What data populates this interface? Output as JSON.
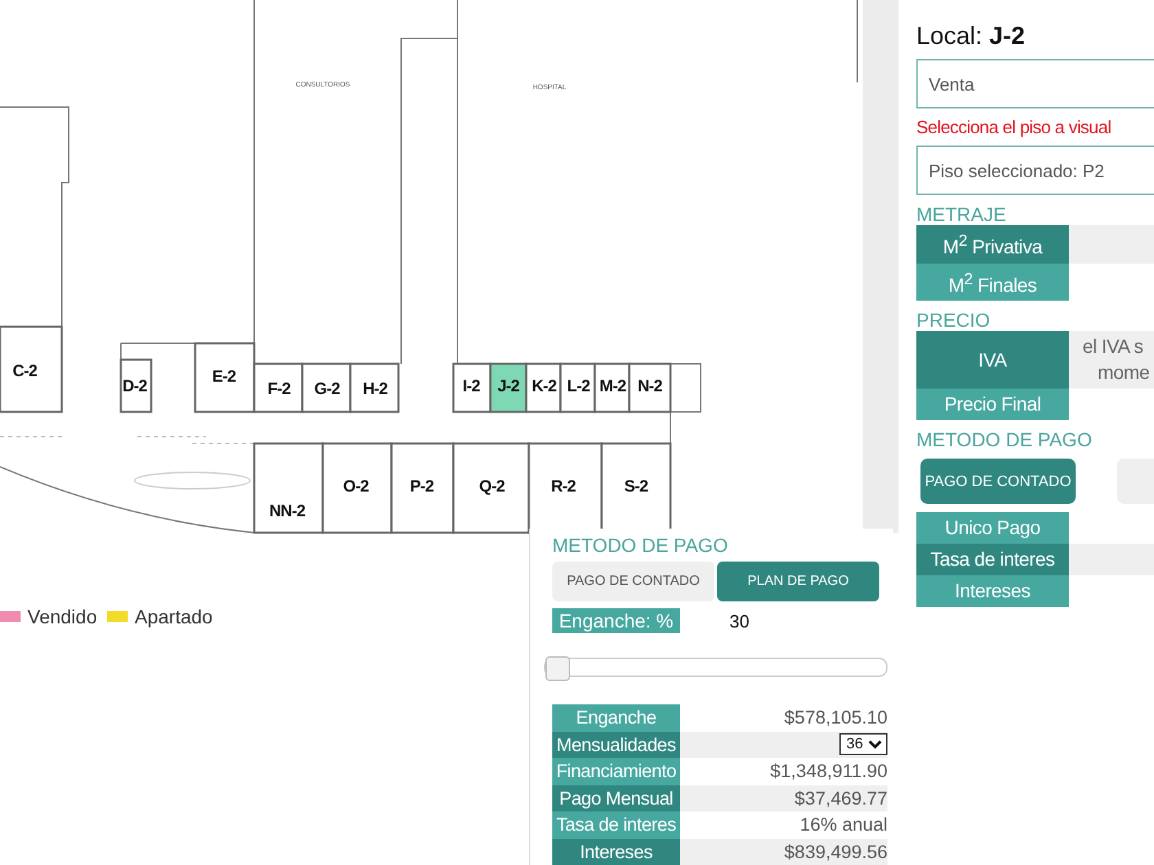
{
  "floor_plan": {
    "area_labels": [
      "CONSULTORIOS",
      "HOSPITAL"
    ],
    "units": [
      {
        "label": "C-2",
        "selected": false
      },
      {
        "label": "D-2",
        "selected": false
      },
      {
        "label": "E-2",
        "selected": false
      },
      {
        "label": "F-2",
        "selected": false
      },
      {
        "label": "G-2",
        "selected": false
      },
      {
        "label": "H-2",
        "selected": false
      },
      {
        "label": "I-2",
        "selected": false
      },
      {
        "label": "J-2",
        "selected": true
      },
      {
        "label": "K-2",
        "selected": false
      },
      {
        "label": "L-2",
        "selected": false
      },
      {
        "label": "M-2",
        "selected": false
      },
      {
        "label": "N-2",
        "selected": false
      },
      {
        "label": "NN-2",
        "selected": false
      },
      {
        "label": "O-2",
        "selected": false
      },
      {
        "label": "P-2",
        "selected": false
      },
      {
        "label": "Q-2",
        "selected": false
      },
      {
        "label": "R-2",
        "selected": false
      },
      {
        "label": "S-2",
        "selected": false
      }
    ],
    "legend": [
      {
        "label": "Vendido",
        "color": "#f08cb0"
      },
      {
        "label": "Apartado",
        "color": "#f2dc2a"
      }
    ]
  },
  "detail_panel": {
    "title_label": "Local:",
    "title_value": "J-2",
    "operation_field": {
      "value": "Venta"
    },
    "floor_prompt": "Selecciona el piso a visual",
    "floor_field": {
      "value": "Piso seleccionado: P2"
    },
    "sections": [
      {
        "heading": "METRAJE",
        "rows": [
          {
            "label": "M$^{2}$ Privativa"
          },
          {
            "label": "M$^{2}$ Finales"
          }
        ]
      },
      {
        "heading": "PRECIO",
        "rows": [
          {
            "label": "IVA",
            "value_lines": [
              "el IVA s",
              "mome"
            ]
          },
          {
            "label": "Precio Final"
          }
        ]
      }
    ],
    "payment_heading": "METODO DE PAGO",
    "payment_tabs": [
      {
        "label": "PAGO DE CONTADO",
        "selected": true
      },
      {
        "selected": false
      }
    ],
    "payment_rows": [
      {
        "label": "Unico Pago"
      },
      {
        "label": "Tasa de interes"
      },
      {
        "label": "Intereses"
      }
    ]
  },
  "plan_panel": {
    "heading": "METODO DE PAGO",
    "tabs": [
      {
        "label": "PAGO DE CONTADO",
        "selected": false
      },
      {
        "label": "PLAN DE PAGO",
        "selected": true
      }
    ],
    "down_payment": {
      "label": "Enganche: %",
      "value": "30"
    },
    "slider": {
      "level": 0
    },
    "rows": [
      {
        "label": "Enganche",
        "kind": "text",
        "value": "$578,105.10"
      },
      {
        "label": "Mensualidades",
        "kind": "select",
        "value": "36"
      },
      {
        "label": "Financiamiento",
        "kind": "text",
        "value": "$1,348,911.90"
      },
      {
        "label": "Pago Mensual",
        "kind": "text",
        "value": "$37,469.77"
      },
      {
        "label": "Tasa de interes",
        "kind": "text",
        "value": "16% anual"
      },
      {
        "label": "Intereses",
        "kind": "text",
        "value": "$839,499.56"
      }
    ]
  }
}
